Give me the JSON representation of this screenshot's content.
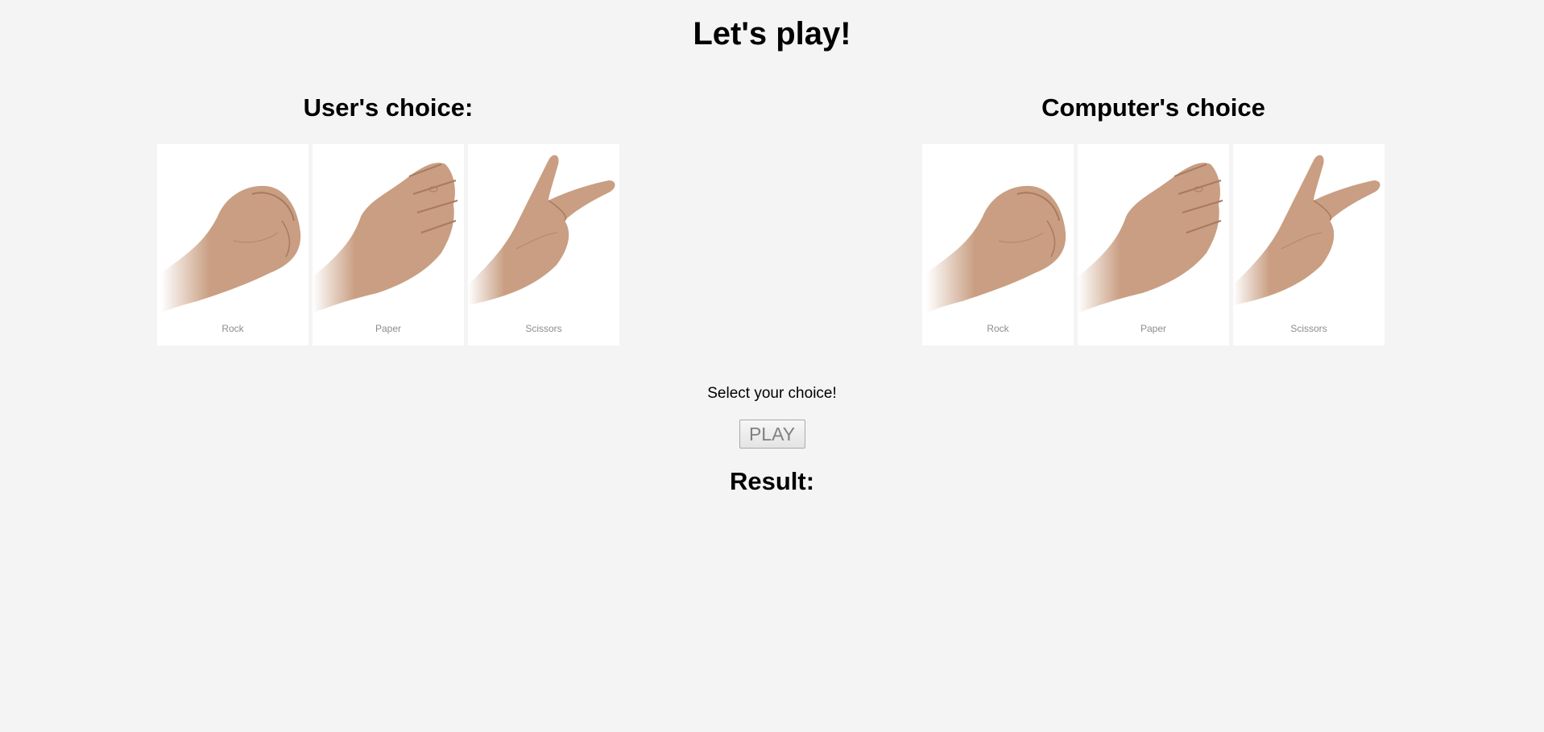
{
  "title": "Let's play!",
  "user_panel": {
    "heading": "User's choice:",
    "choices": [
      {
        "label": "Rock",
        "icon": "rock-hand-icon"
      },
      {
        "label": "Paper",
        "icon": "paper-hand-icon"
      },
      {
        "label": "Scissors",
        "icon": "scissors-hand-icon"
      }
    ]
  },
  "computer_panel": {
    "heading": "Computer's choice",
    "choices": [
      {
        "label": "Rock",
        "icon": "rock-hand-icon"
      },
      {
        "label": "Paper",
        "icon": "paper-hand-icon"
      },
      {
        "label": "Scissors",
        "icon": "scissors-hand-icon"
      }
    ]
  },
  "status_message": "Select your choice!",
  "play_button_label": "PLAY",
  "result_label": "Result:",
  "colors": {
    "background": "#f4f4f4",
    "card_background": "#ffffff",
    "skin": "#c99e82",
    "skin_shadow": "#a87a5f",
    "label_gray": "#8c8c8c"
  }
}
